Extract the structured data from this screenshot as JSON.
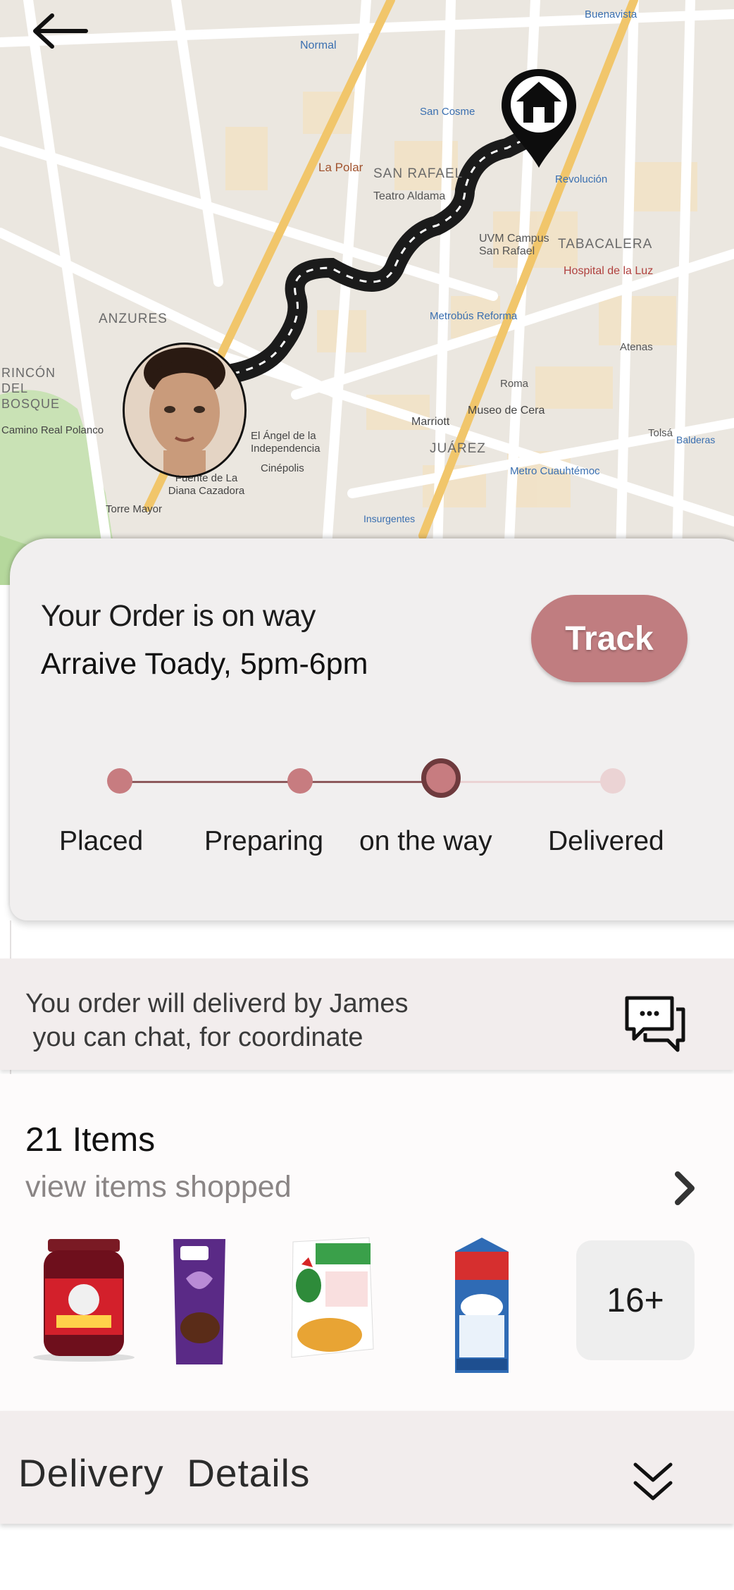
{
  "map": {
    "labels": {
      "normal": "Normal",
      "la_polar": "La Polar",
      "san_rafael": "SAN RAFAEL",
      "teatro": "Teatro Aldama",
      "uvm": "UVM Campus San Rafael",
      "tabacalera": "TABACALERA",
      "hospital": "Hospital de la Luz",
      "anzures": "ANZURES",
      "rincon": "RINCÓN DEL BOSQUE",
      "juarez": "JUÁREZ",
      "marriott": "Marriott",
      "museo": "Museo de Cera",
      "cinepolis": "Cinépolis",
      "angel": "El Ángel de la Independencia",
      "fuente": "Fuente de La Diana Cazadora",
      "torre": "Torre Mayor",
      "camino": "Camino Real Polanco",
      "revolucion": "Revolución",
      "san_cosme": "San Cosme",
      "buenavista": "Buenavista",
      "metrobus": "Metrobús Reforma",
      "metro_cuau": "Metro Cuauhtémoc",
      "insurgentes": "Insurgentes",
      "roma": "Roma",
      "tolsa": "Tolsá",
      "atenas": "Atenas",
      "balderas": "Balderas"
    },
    "icons": {
      "back": "arrow-left-icon",
      "destination": "home-pin-icon"
    }
  },
  "order": {
    "title": "Your Order is on way",
    "time": "Arraive Toady, 5pm-6pm",
    "track_label": "Track",
    "steps": [
      "Placed",
      "Preparing",
      "on the way",
      "Delivered"
    ],
    "current_step": 2
  },
  "courier": {
    "line1": "You order will deliverd by James",
    "line2": " you can chat, for coordinate",
    "icon": "chat-icon"
  },
  "items": {
    "count": "21 Items",
    "link": "view items shopped",
    "products": [
      "Smucker's Strawberry Jam",
      "Cadbury Dairy Milk Silk",
      "Kellogg's Corn Flakes",
      "Stenyfield Organic Whole Milk"
    ],
    "more": "16+"
  },
  "delivery": {
    "title": "Delivery  Details"
  },
  "colors": {
    "accent": "#c07d80",
    "dot": "#c77c80",
    "current_ring": "#7a3a3e",
    "inactive": "#ebd3d4"
  }
}
